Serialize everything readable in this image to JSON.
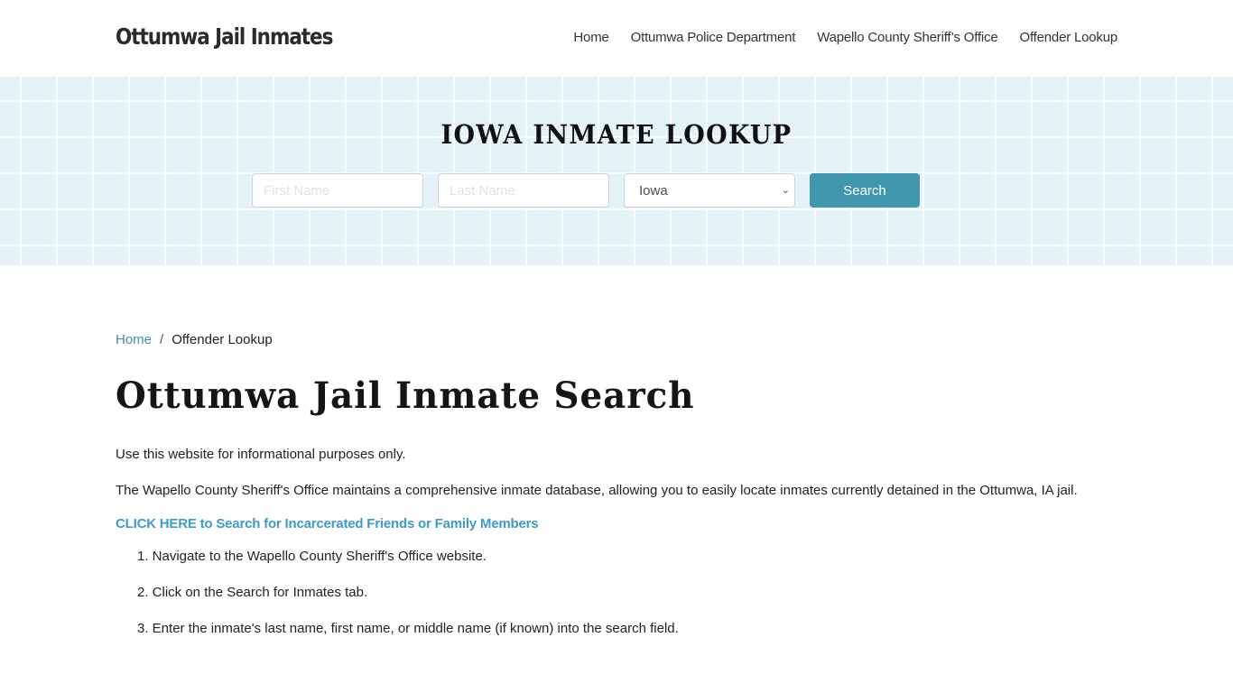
{
  "header": {
    "brand": "Ottumwa Jail Inmates",
    "nav": [
      {
        "label": "Home"
      },
      {
        "label": "Ottumwa Police Department"
      },
      {
        "label": "Wapello County Sheriff’s Office"
      },
      {
        "label": "Offender Lookup"
      }
    ]
  },
  "hero": {
    "title": "IOWA INMATE LOOKUP",
    "first_name_placeholder": "First Name",
    "last_name_placeholder": "Last Name",
    "state_selected": "Iowa",
    "search_label": "Search"
  },
  "breadcrumb": {
    "home": "Home",
    "separator": "/",
    "current": "Offender Lookup"
  },
  "main": {
    "title": "Ottumwa Jail Inmate Search",
    "para1": "Use this website for informational purposes only.",
    "para2": "The Wapello County Sheriff's Office maintains a comprehensive inmate database, allowing you to easily locate inmates currently detained in the Ottumwa, IA jail.",
    "cta": "CLICK HERE to Search for Incarcerated Friends or Family Members",
    "steps": [
      "1. Navigate to the Wapello County Sheriff's Office website.",
      "2. Click on the Search for Inmates tab.",
      "3. Enter the inmate's last name, first name, or middle name (if known) into the search field."
    ]
  },
  "colors": {
    "accent": "#4096ad",
    "link": "#3b9bcc",
    "hero_bg": "#e3f3f7"
  }
}
